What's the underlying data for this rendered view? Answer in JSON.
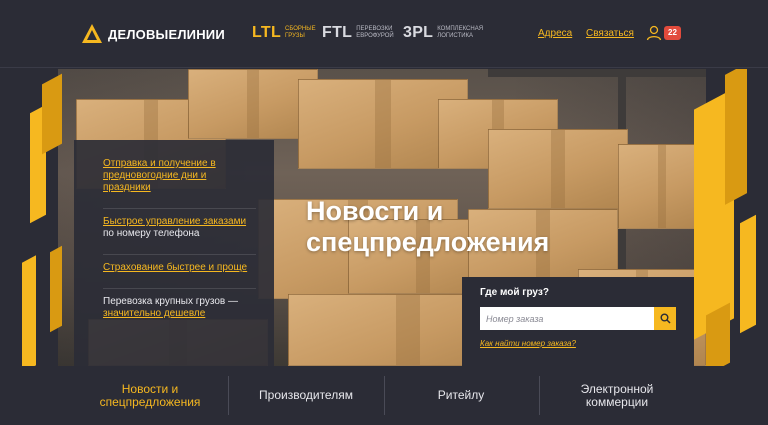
{
  "header": {
    "logo_text": "ДЕЛОВЫЕЛИНИИ",
    "services": [
      {
        "code": "LTL",
        "description": "СБОРНЫЕ ГРУЗЫ"
      },
      {
        "code": "FTL",
        "description": "ПЕРЕВОЗКИ ЕВРОФУРОЙ"
      },
      {
        "code": "3PL",
        "description": "КОМПЛЕКСНАЯ ЛОГИСТИКА"
      }
    ],
    "links": {
      "addresses": "Адреса",
      "contact": "Связаться"
    },
    "notifications_count": "22",
    "icons": {
      "logo": "logo-icon",
      "user": "user-icon"
    }
  },
  "hero": {
    "title_line1": "Новости и",
    "title_line2": "спецпредложения",
    "news": [
      {
        "link": "Отправка и получение в предновогодние дни и праздники",
        "rest": ""
      },
      {
        "link": "Быстрое управление заказами",
        "rest": " по номеру телефона"
      },
      {
        "link": "Страхование быстрее и проще",
        "rest": ""
      },
      {
        "prefix": "Перевозка крупных грузов — ",
        "link": "значительно дешевле"
      }
    ]
  },
  "tracking": {
    "title": "Где мой груз?",
    "placeholder": "Номер заказа",
    "help_link": "Как найти номер заказа?",
    "search_icon": "search-icon"
  },
  "bottom_nav": [
    {
      "label": "Новости и спецпредложения",
      "active": true
    },
    {
      "label": "Производителям",
      "active": false
    },
    {
      "label": "Ритейлу",
      "active": false
    },
    {
      "label": "Электронной коммерции",
      "active": false
    }
  ],
  "colors": {
    "accent": "#f6b820",
    "background": "#2b2c36",
    "badge": "#e24b3c"
  }
}
